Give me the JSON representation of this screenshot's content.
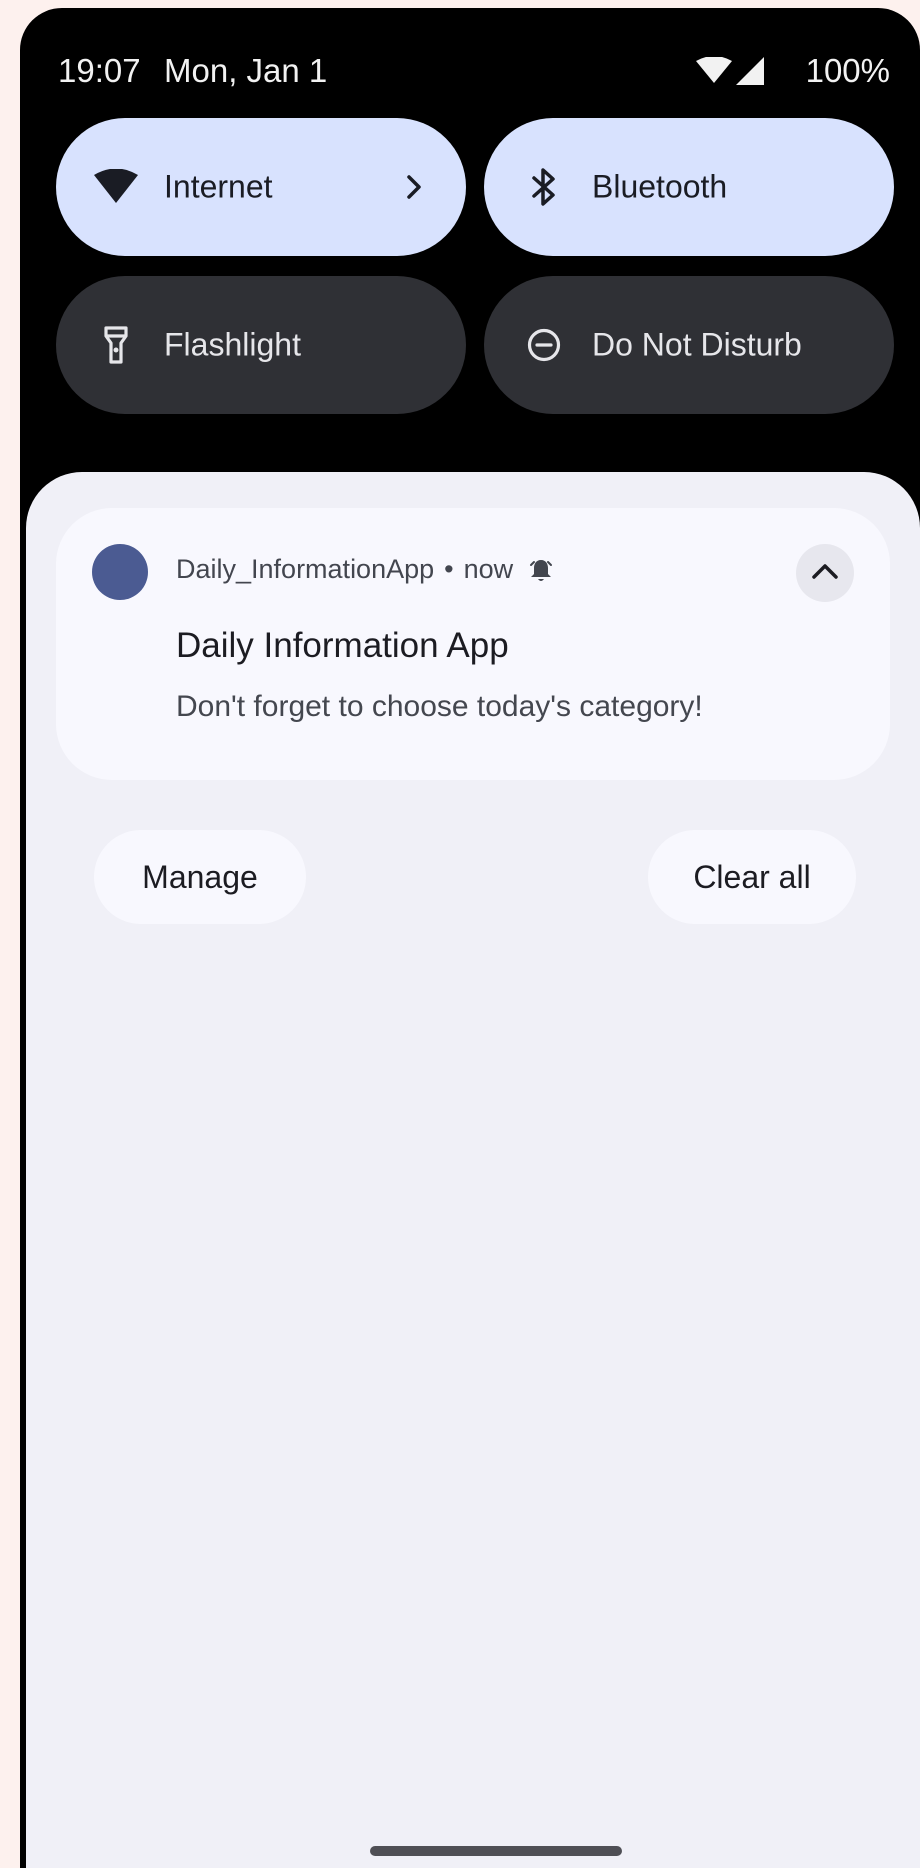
{
  "status_bar": {
    "time": "19:07",
    "date": "Mon, Jan 1",
    "battery": "100%",
    "wifi_icon": "wifi-icon",
    "signal_icon": "cellular-signal-icon"
  },
  "quick_settings": {
    "tiles": [
      {
        "label": "Internet",
        "icon": "wifi-icon",
        "state": "on",
        "has_chevron": true
      },
      {
        "label": "Bluetooth",
        "icon": "bluetooth-icon",
        "state": "on"
      },
      {
        "label": "Flashlight",
        "icon": "flashlight-icon",
        "state": "off"
      },
      {
        "label": "Do Not Disturb",
        "icon": "do-not-disturb-icon",
        "state": "off"
      }
    ]
  },
  "notification": {
    "app_name": "Daily_InformationApp",
    "separator": "•",
    "time": "now",
    "title": "Daily Information App",
    "text": "Don't forget to choose today's category!",
    "app_icon_color": "#4b5b92"
  },
  "actions": {
    "manage": "Manage",
    "clear_all": "Clear all"
  },
  "colors": {
    "tile_on": "#d8e2fe",
    "tile_off": "#2f3035",
    "shade_background": "#f0f0f7",
    "card_background": "#f8f8fe"
  }
}
